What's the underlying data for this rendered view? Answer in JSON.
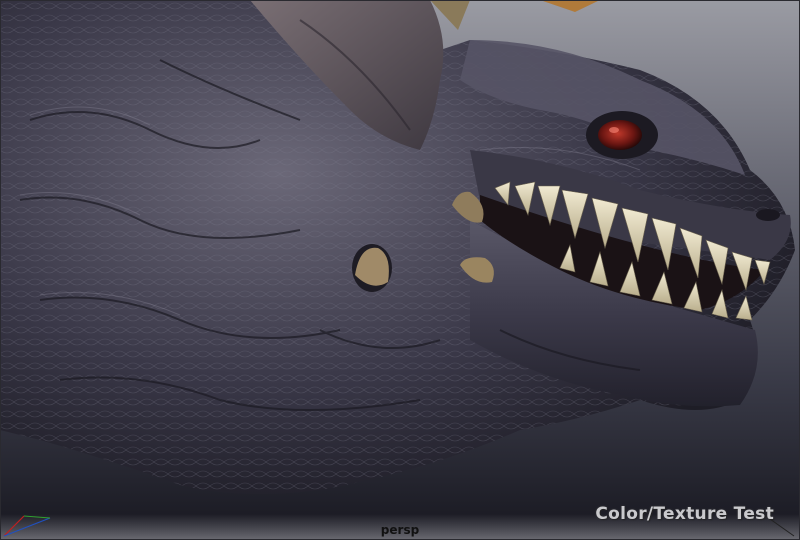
{
  "viewport": {
    "camera_name": "persp",
    "overlay_text": "Color/Texture Test",
    "background_top": "#9a9ba3",
    "background_bottom": "#17171f"
  },
  "icons": {
    "axis_gizmo": "xyz-axis-icon",
    "corner_marker": "viewport-corner-icon"
  },
  "colors": {
    "skin_dark": "#2b2a38",
    "skin_mid": "#4e4c5e",
    "skin_highlight": "#8a8797",
    "teeth": "#e4dcc0",
    "eye": "#7a1e1a",
    "horn": "#a08a68"
  }
}
